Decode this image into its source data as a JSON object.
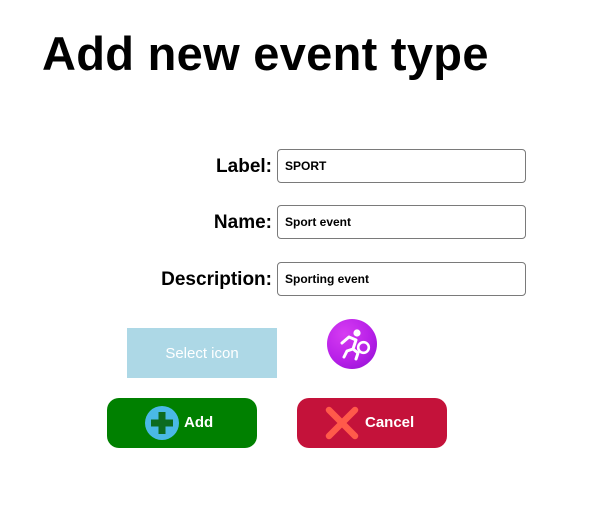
{
  "page": {
    "title": "Add new event type"
  },
  "form": {
    "label": {
      "caption": "Label:",
      "value": "SPORT"
    },
    "name": {
      "caption": "Name:",
      "value": "Sport event"
    },
    "description": {
      "caption": "Description:",
      "value": "Sporting event"
    }
  },
  "select_icon": {
    "label": "Select icon"
  },
  "icon_preview": {
    "icon": "sport-runner-icon",
    "color": "#b820e8"
  },
  "actions": {
    "add": {
      "label": "Add",
      "icon": "plus-circle-icon",
      "color": "#008000"
    },
    "cancel": {
      "label": "Cancel",
      "icon": "close-x-icon",
      "color": "#c4123a"
    }
  }
}
